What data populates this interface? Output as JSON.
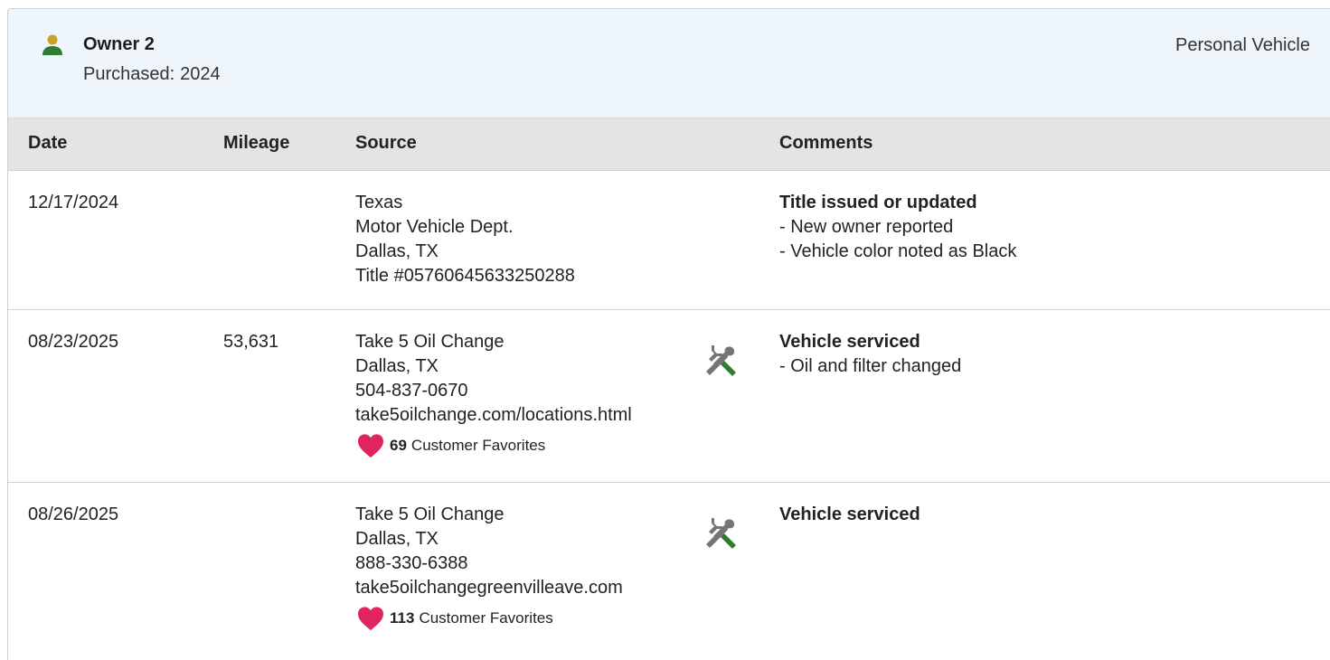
{
  "owner": {
    "name": "Owner 2",
    "purchased_label": "Purchased:",
    "purchased_year": "2024",
    "vehicle_type": "Personal Vehicle",
    "icon": "person-icon",
    "icon_colors": {
      "head": "#c9a227",
      "body": "#2e7d32"
    }
  },
  "columns": {
    "date": "Date",
    "mileage": "Mileage",
    "source": "Source",
    "comments": "Comments"
  },
  "records": [
    {
      "date": "12/17/2024",
      "mileage": "",
      "source": [
        "Texas",
        "Motor Vehicle Dept.",
        "Dallas, TX",
        "Title #05760645633250288"
      ],
      "icon": "",
      "comment_title": "Title issued or updated",
      "comment_items": [
        "New owner reported",
        "Vehicle color noted as Black"
      ]
    },
    {
      "date": "08/23/2025",
      "mileage": "53,631",
      "source": [
        "Take 5 Oil Change",
        "Dallas, TX",
        "504-837-0670",
        "take5oilchange.com/locations.html"
      ],
      "favorites_count": "69",
      "favorites_label": "Customer Favorites",
      "icon": "service-tools-icon",
      "comment_title": "Vehicle serviced",
      "comment_items": [
        "Oil and filter changed"
      ]
    },
    {
      "date": "08/26/2025",
      "mileage": "",
      "source": [
        "Take 5 Oil Change",
        "Dallas, TX",
        "888-330-6388",
        "take5oilchangegreenvilleave.com"
      ],
      "favorites_count": "113",
      "favorites_label": "Customer Favorites",
      "icon": "service-tools-icon",
      "comment_title": "Vehicle serviced",
      "comment_items": []
    }
  ],
  "colors": {
    "header_bg": "#eef5fb",
    "table_head_bg": "#e4e4e4",
    "heart": "#e0245e",
    "tool_grey": "#757575",
    "tool_green": "#2e7d32"
  }
}
